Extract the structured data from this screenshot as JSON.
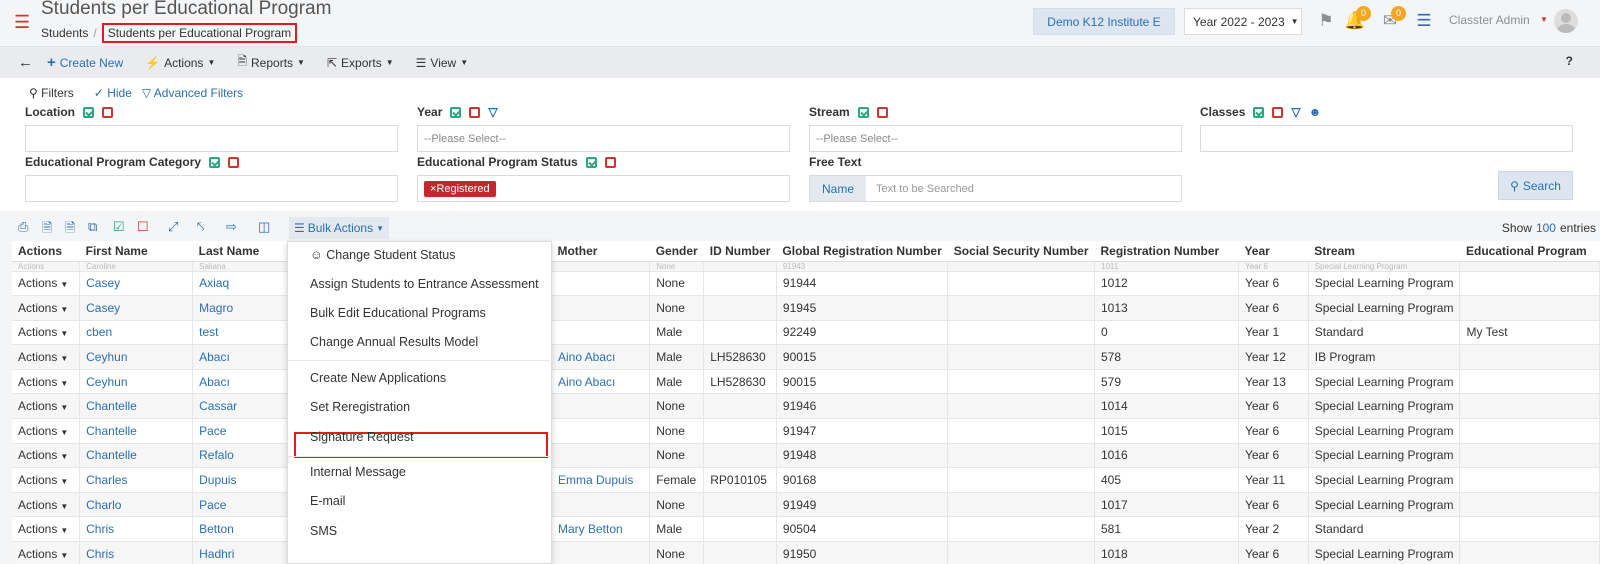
{
  "header": {
    "title": "Students per Educational Program",
    "breadcrumb": [
      "Students",
      "Students per Educational Program"
    ],
    "institute": "Demo K12 Institute E",
    "year": "Year 2022 - 2023",
    "notifications_count": "0",
    "messages_count": "0",
    "user": "Classter Admin"
  },
  "toolbar": {
    "create_new": "Create New",
    "actions": "Actions",
    "reports": "Reports",
    "exports": "Exports",
    "view": "View",
    "help": "?"
  },
  "filters": {
    "filters_label": "Filters",
    "hide_label": "Hide",
    "advanced_label": "Advanced Filters",
    "location": {
      "label": "Location",
      "value": ""
    },
    "year": {
      "label": "Year",
      "placeholder": "--Please Select--"
    },
    "stream": {
      "label": "Stream",
      "placeholder": "--Please Select--"
    },
    "classes": {
      "label": "Classes",
      "value": ""
    },
    "category": {
      "label": "Educational Program Category",
      "value": ""
    },
    "status": {
      "label": "Educational Program Status",
      "tag": "Registered"
    },
    "free_text": {
      "label": "Free Text",
      "prefix": "Name",
      "placeholder": "Text to be Searched"
    },
    "search_button": "Search"
  },
  "table_tools": {
    "bulk_actions": "Bulk Actions",
    "show_label": "Show",
    "show_count": "100",
    "entries_label": "entries"
  },
  "table": {
    "columns": [
      "Actions",
      "First Name",
      "Last Name",
      "",
      "Mother",
      "Gender",
      "ID Number",
      "Global Registration Number",
      "Social Security Number",
      "Registration Number",
      "Year",
      "Stream",
      "Educational Program"
    ],
    "partial_row": [
      "Actions",
      "Caroline",
      "Saliana",
      "",
      "",
      "None",
      "",
      "91943",
      "",
      "1011",
      "Year 6",
      "Special Learning Program",
      ""
    ],
    "rows": [
      [
        "Actions",
        "Casey",
        "Axiaq",
        "",
        "",
        "None",
        "",
        "91944",
        "",
        "1012",
        "Year 6",
        "Special Learning Program",
        ""
      ],
      [
        "Actions",
        "Casey",
        "Magro",
        "",
        "",
        "None",
        "",
        "91945",
        "",
        "1013",
        "Year 6",
        "Special Learning Program",
        ""
      ],
      [
        "Actions",
        "cben",
        "test",
        "",
        "",
        "Male",
        "",
        "92249",
        "",
        "0",
        "Year 1",
        "Standard",
        "My Test"
      ],
      [
        "Actions",
        "Ceyhun",
        "Abacı",
        "",
        "Aino Abacı",
        "Male",
        "LH528630",
        "90015",
        "",
        "578",
        "Year 12",
        "IB Program",
        ""
      ],
      [
        "Actions",
        "Ceyhun",
        "Abacı",
        "",
        "Aino Abacı",
        "Male",
        "LH528630",
        "90015",
        "",
        "579",
        "Year 13",
        "Special Learning Program",
        ""
      ],
      [
        "Actions",
        "Chantelle",
        "Cassar",
        "",
        "",
        "None",
        "",
        "91946",
        "",
        "1014",
        "Year 6",
        "Special Learning Program",
        ""
      ],
      [
        "Actions",
        "Chantelle",
        "Pace",
        "",
        "",
        "None",
        "",
        "91947",
        "",
        "1015",
        "Year 6",
        "Special Learning Program",
        ""
      ],
      [
        "Actions",
        "Chantelle",
        "Refalo",
        "",
        "",
        "None",
        "",
        "91948",
        "",
        "1016",
        "Year 6",
        "Special Learning Program",
        ""
      ],
      [
        "Actions",
        "Charles",
        "Dupuis",
        "",
        "Emma Dupuis",
        "Female",
        "RP010105",
        "90168",
        "",
        "405",
        "Year 11",
        "Special Learning Program",
        ""
      ],
      [
        "Actions",
        "Charlo",
        "Pace",
        "",
        "",
        "None",
        "",
        "91949",
        "",
        "1017",
        "Year 6",
        "Special Learning Program",
        ""
      ],
      [
        "Actions",
        "Chris",
        "Betton",
        "",
        "Mary Betton",
        "Male",
        "",
        "90504",
        "",
        "581",
        "Year 2",
        "Standard",
        ""
      ],
      [
        "Actions",
        "Chris",
        "Hadhri",
        "",
        "",
        "None",
        "",
        "91950",
        "",
        "1018",
        "Year 6",
        "Special Learning Program",
        ""
      ]
    ]
  },
  "bulk_menu": {
    "items": [
      "Change Student Status",
      "Assign Students to Entrance Assessment",
      "Bulk Edit Educational Programs",
      "Change Annual Results Model",
      "Create New Applications",
      "Set Reregistration",
      "Signature Request",
      "Internal Message",
      "E-mail",
      "SMS"
    ]
  },
  "colors": {
    "accent": "#2a6fb5",
    "brand_red": "#d0342c",
    "highlight": "#e21b1b",
    "tag_bg": "#c1272d",
    "badge": "#f5a623"
  }
}
